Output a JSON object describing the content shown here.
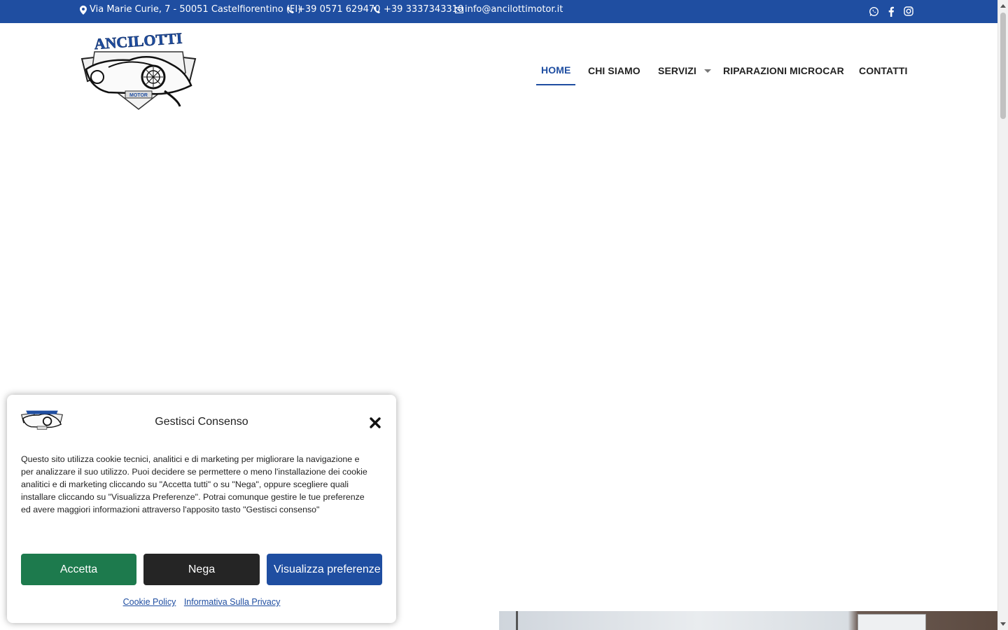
{
  "topbar": {
    "address": "Via Marie Curie, 7 - 50051 Castelfiorentino (FI)",
    "phone1": "+39 0571 629470",
    "phone2": "+39 3337343310",
    "email": "info@ancilottimotor.it",
    "social": [
      "whatsapp-icon",
      "facebook-icon",
      "instagram-icon"
    ],
    "bg_color": "#1f4ea1"
  },
  "logo": {
    "brand_text": "ANCILOTTI",
    "sub_text": "MOTOR"
  },
  "nav": {
    "items": [
      {
        "label": "HOME",
        "active": true
      },
      {
        "label": "CHI SIAMO",
        "active": false
      },
      {
        "label": "SERVIZI",
        "active": false,
        "has_dropdown": true
      },
      {
        "label": "RIPARAZIONI MICROCAR",
        "active": false
      },
      {
        "label": "CONTATTI",
        "active": false
      }
    ],
    "active_color": "#1f4ea1"
  },
  "cookie": {
    "title": "Gestisci Consenso",
    "text": "Questo sito utilizza cookie tecnici, analitici e di marketing per migliorare la navigazione e per analizzare il suo utilizzo. Puoi decidere se permettere o meno l'installazione dei cookie analitici e di marketing cliccando su \"Accetta tutti\" o su \"Nega\", oppure scegliere quali installare cliccando su \"Visualizza Preferenze\". Potrai comunque gestire le tue preferenze ed avere maggiori informazioni attraverso l'apposito tasto \"Gestisci consenso\"",
    "accept_label": "Accetta",
    "deny_label": "Nega",
    "prefs_label": "Visualizza preferenze",
    "link_cookie_policy": "Cookie Policy",
    "link_privacy": "Informativa Sulla Privacy",
    "accept_color": "#1d7a4d",
    "deny_color": "#252525",
    "prefs_color": "#1f4ea1"
  }
}
